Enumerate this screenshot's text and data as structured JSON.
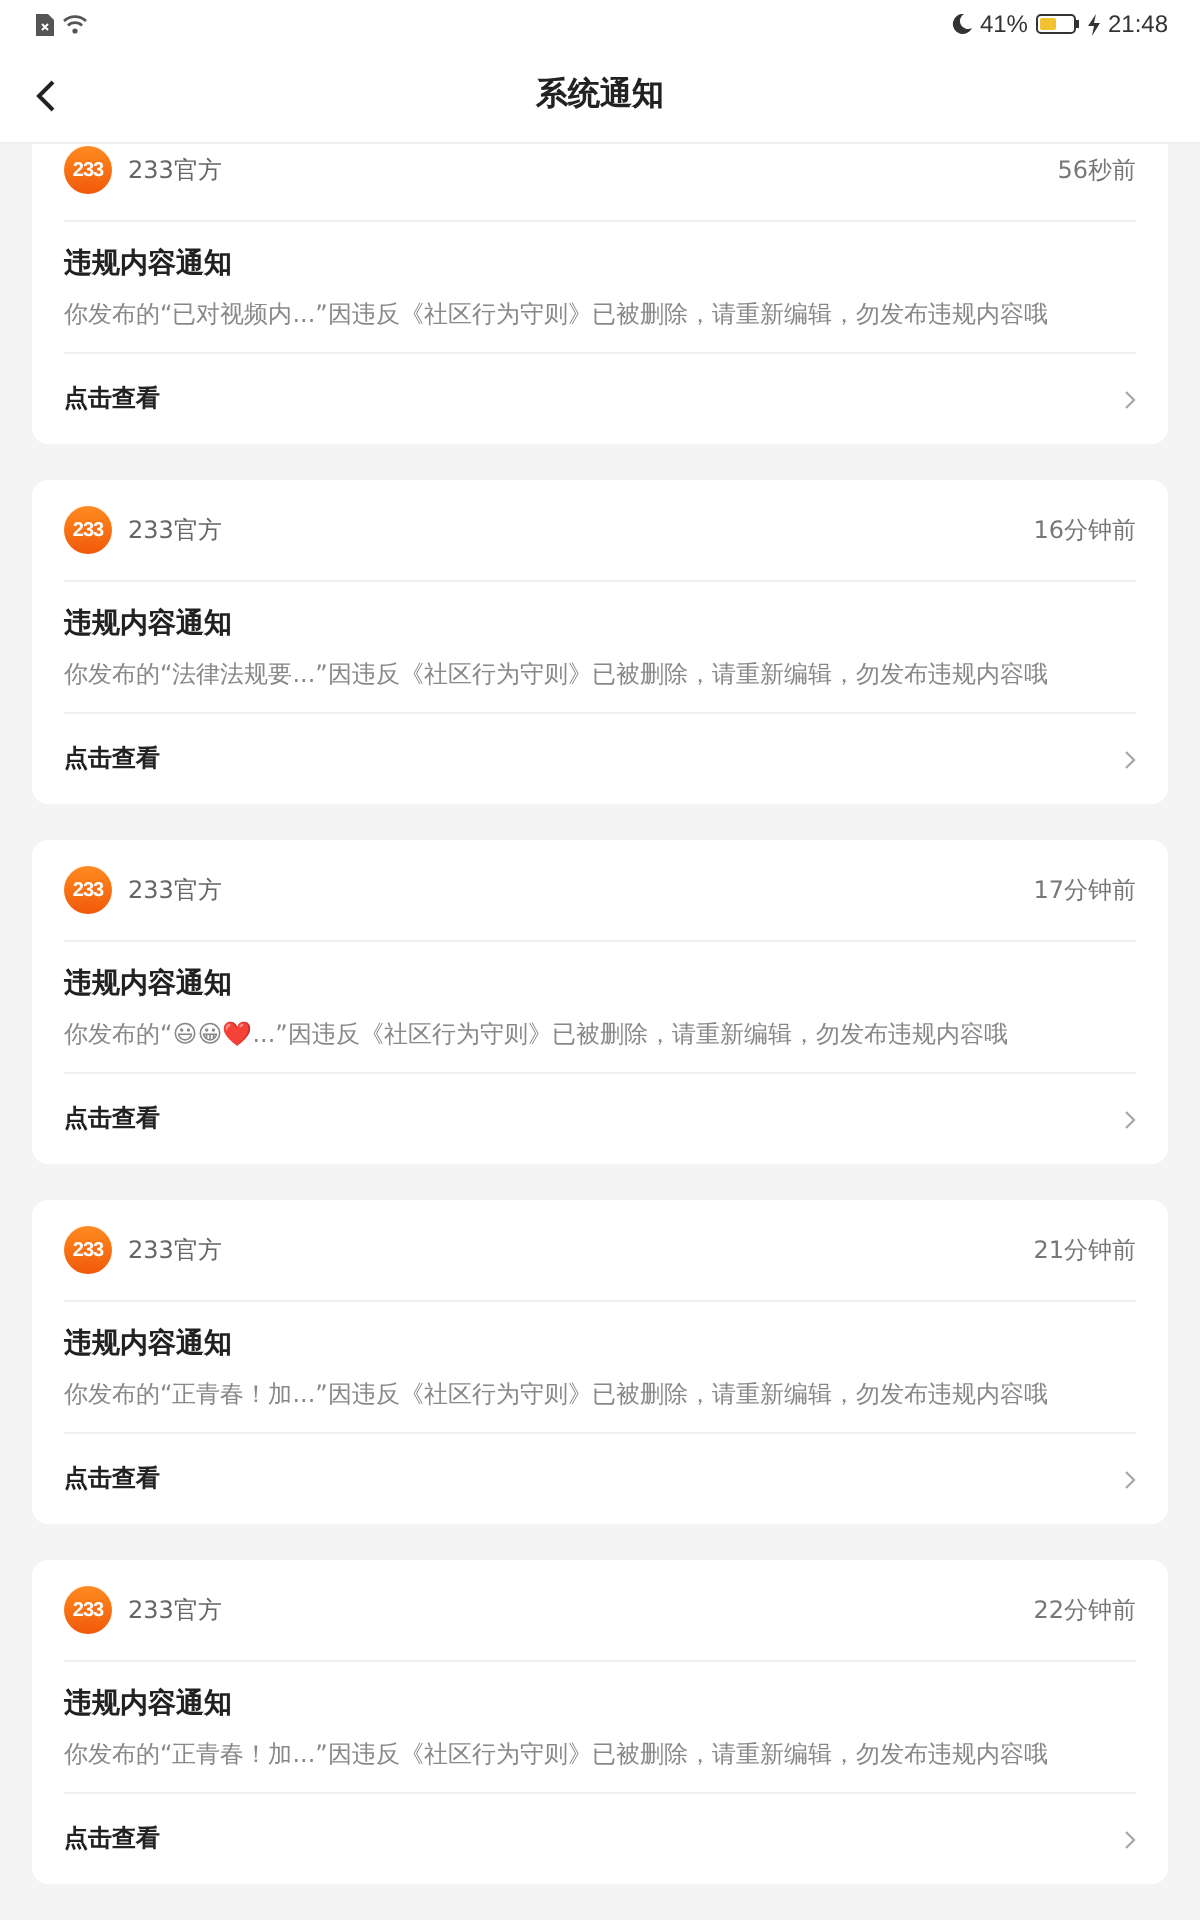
{
  "status_bar": {
    "battery": "41%",
    "time": "21:48"
  },
  "header": {
    "title": "系统通知"
  },
  "notifications": [
    {
      "logo": "233",
      "sender": "233官方",
      "time": "56秒前",
      "title": "违规内容通知",
      "message": "你发布的“已对视频内...”因违反《社区行为守则》已被删除，请重新编辑，勿发布违规内容哦",
      "action": "点击查看"
    },
    {
      "logo": "233",
      "sender": "233官方",
      "time": "16分钟前",
      "title": "违规内容通知",
      "message": "你发布的“法律法规要...”因违反《社区行为守则》已被删除，请重新编辑，勿发布违规内容哦",
      "action": "点击查看"
    },
    {
      "logo": "233",
      "sender": "233官方",
      "time": "17分钟前",
      "title": "违规内容通知",
      "message": "你发布的“😃😀❤️...”因违反《社区行为守则》已被删除，请重新编辑，勿发布违规内容哦",
      "action": "点击查看"
    },
    {
      "logo": "233",
      "sender": "233官方",
      "time": "21分钟前",
      "title": "违规内容通知",
      "message": "你发布的“正青春！加...”因违反《社区行为守则》已被删除，请重新编辑，勿发布违规内容哦",
      "action": "点击查看"
    },
    {
      "logo": "233",
      "sender": "233官方",
      "time": "22分钟前",
      "title": "违规内容通知",
      "message": "你发布的“正青春！加...”因违反《社区行为守则》已被删除，请重新编辑，勿发布违规内容哦",
      "action": "点击查看"
    }
  ]
}
